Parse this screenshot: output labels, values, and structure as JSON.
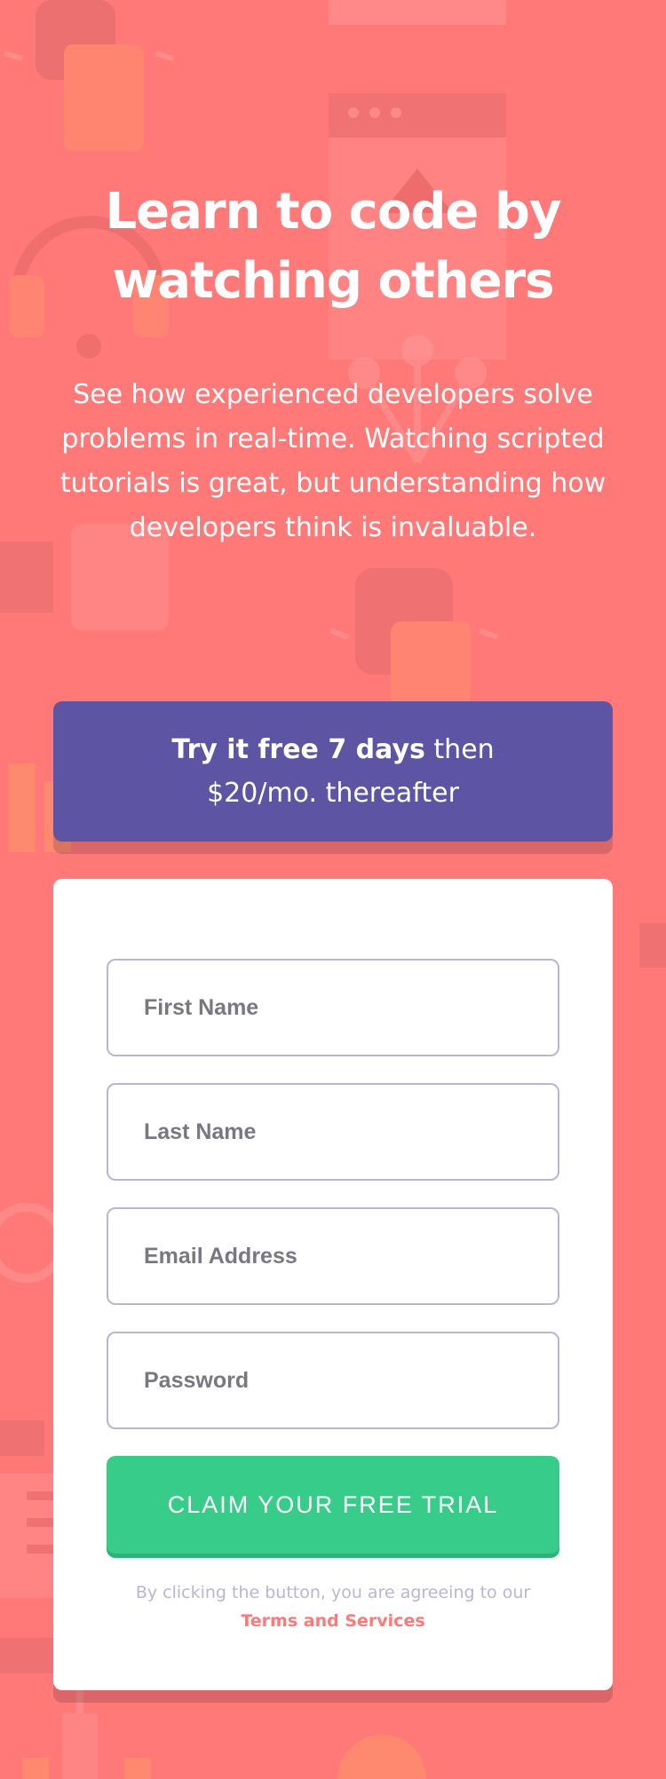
{
  "hero": {
    "headline_line1": "Learn to code by",
    "headline_line2": "watching others",
    "description": "See how experienced developers solve problems in real-time. Watching scripted tutorials is great, but understanding how developers think is invaluable."
  },
  "promo": {
    "strong_text": "Try it free 7 days",
    "rest_text_1": " then",
    "rest_text_2": "$20/mo. thereafter"
  },
  "form": {
    "first_name_placeholder": "First Name",
    "last_name_placeholder": "Last Name",
    "email_placeholder": "Email Address",
    "password_placeholder": "Password",
    "submit_label": "CLAIM YOUR FREE TRIAL",
    "terms_text": "By clicking the button, you are agreeing to our",
    "terms_link": "Terms and Services"
  },
  "colors": {
    "background": "#ff7979",
    "promo": "#5e54a4",
    "button": "#38cc8b",
    "field_border": "#b9b6d3",
    "terms_link": "#ff7979"
  },
  "icons": [
    "usb-plug-icon",
    "browser-window-icon",
    "headset-icon",
    "network-nodes-icon",
    "usb-plug-icon",
    "document-icon",
    "calendar-icon",
    "hierarchy-icon"
  ]
}
